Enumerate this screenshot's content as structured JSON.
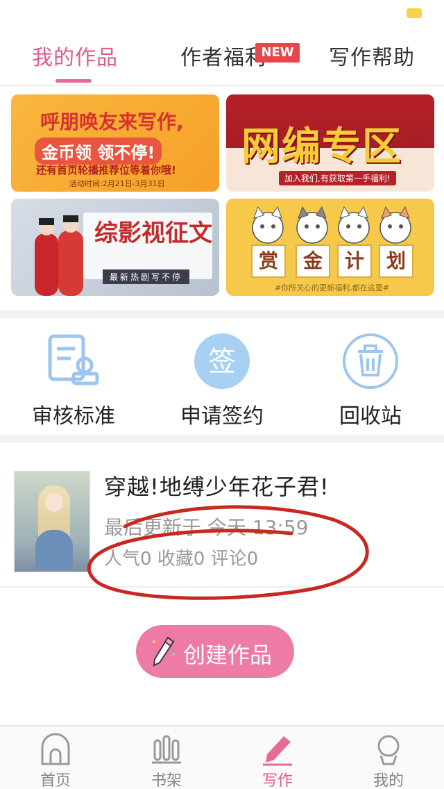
{
  "top_tabs": {
    "items": [
      {
        "label": "我的作品",
        "active": true
      },
      {
        "label": "作者福利",
        "badge": "NEW"
      },
      {
        "label": "写作帮助"
      }
    ]
  },
  "banners": {
    "welfare": {
      "title": "呼朋唤友来写作,",
      "coin_line": "金币领 领不停!",
      "promo_line": "还有首页轮播推荐位等着你哦!",
      "date": "活动时间:2月21日-3月31日"
    },
    "net_editor": {
      "title": "网编专区",
      "subtitle": "加入我们,有获取第一手福利!"
    },
    "drama": {
      "title": "综影视征文",
      "subtitle": "最新热剧写不停"
    },
    "bounty": {
      "words": [
        "赏",
        "金",
        "计",
        "划"
      ],
      "footer": "#你所关心的更新福利,都在这里#"
    }
  },
  "tools": [
    {
      "label": "审核标准",
      "icon": "review-doc-icon"
    },
    {
      "label": "申请签约",
      "icon": "sign-badge-icon",
      "icon_text": "签"
    },
    {
      "label": "回收站",
      "icon": "trash-icon"
    }
  ],
  "work": {
    "title": "穿越!地缚少年花子君!",
    "updated": "最后更新于 今天 13:59",
    "stats": "人气0 收藏0 评论0"
  },
  "create_button": {
    "label": "创建作品"
  },
  "bottom_nav": [
    {
      "label": "首页",
      "icon": "home-icon"
    },
    {
      "label": "书架",
      "icon": "bookshelf-icon"
    },
    {
      "label": "写作",
      "icon": "pen-icon",
      "active": true
    },
    {
      "label": "我的",
      "icon": "profile-icon"
    }
  ],
  "colors": {
    "accent": "#e05a8a",
    "button_pink": "#ee7aa6",
    "badge_red": "#e8454d",
    "tool_blue": "#9cc6ef"
  }
}
